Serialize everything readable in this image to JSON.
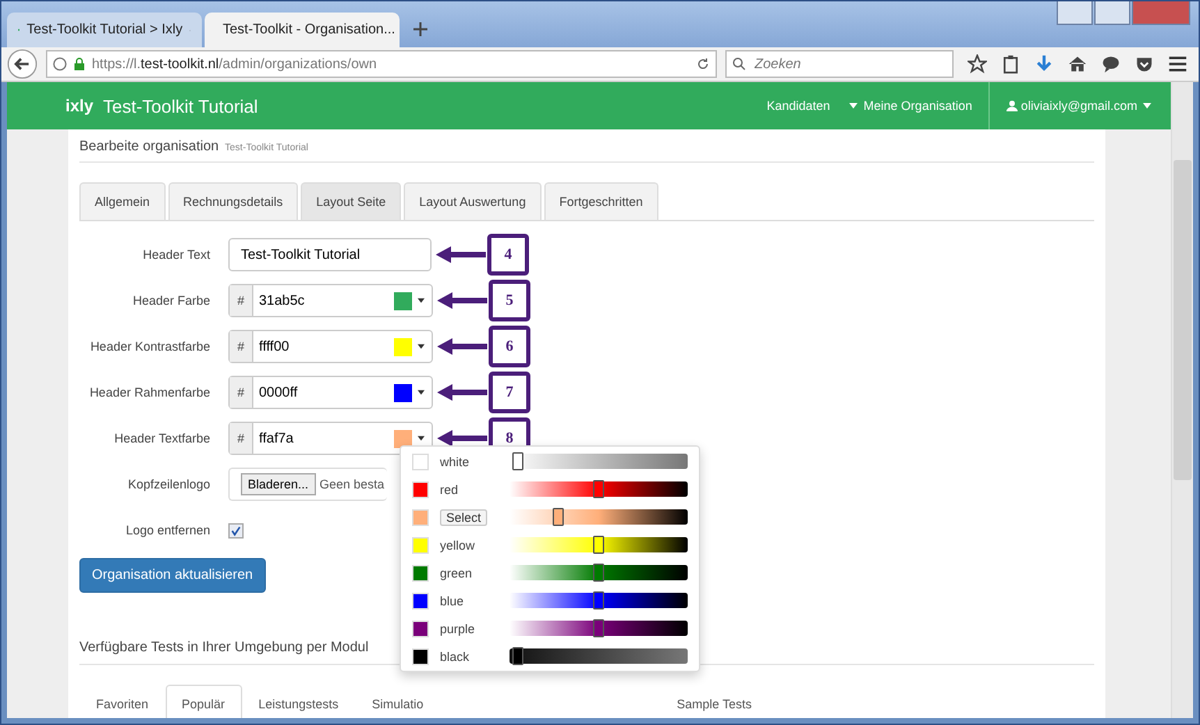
{
  "browser": {
    "tabs": [
      {
        "title": "Test-Toolkit Tutorial > Ixly",
        "selected": false
      },
      {
        "title": "Test-Toolkit - Organisation...",
        "selected": true
      }
    ],
    "url": "https://l.**test-toolkit.nl**/admin/organizations/own",
    "search": {
      "placeholder": "Zoeken"
    }
  },
  "navbar": {
    "logo": "ixly",
    "title": "Test-Toolkit Tutorial",
    "links": [
      {
        "label": "Kandidaten",
        "caret": false
      },
      {
        "label": "Meine Organisation",
        "caret": true
      }
    ],
    "user": {
      "label": "oliviaixly@gmail.com",
      "caret": true
    }
  },
  "heading": {
    "title": "Bearbeite organisation",
    "subtitle": "Test-Toolkit Tutorial"
  },
  "tabs": [
    {
      "label": "Allgemein",
      "selected": false
    },
    {
      "label": "Rechnungsdetails",
      "selected": false
    },
    {
      "label": "Layout Seite",
      "selected": true
    },
    {
      "label": "Layout Auswertung",
      "selected": false
    },
    {
      "label": "Fortgeschritten",
      "selected": false
    }
  ],
  "fields": [
    {
      "kind": "text",
      "label": "Header Text",
      "value": "Test-Toolkit Tutorial",
      "callout": "4"
    },
    {
      "kind": "color",
      "label": "Header Farbe",
      "prefix": "#",
      "value": "31ab5c",
      "color": "#31ab5c",
      "callout": "5"
    },
    {
      "kind": "color",
      "label": "Header Kontrastfarbe",
      "prefix": "#",
      "value": "ffff00",
      "color": "#ffff00",
      "callout": "6"
    },
    {
      "kind": "color",
      "label": "Header Rahmenfarbe",
      "prefix": "#",
      "value": "0000ff",
      "color": "#0000ff",
      "callout": "7"
    },
    {
      "kind": "color",
      "label": "Header Textfarbe",
      "prefix": "#",
      "value": "ffaf7a",
      "color": "#ffaf7a",
      "callout": "8"
    },
    {
      "kind": "file",
      "label": "Kopfzeilenlogo",
      "button": "Bladeren...",
      "value": "Geen besta"
    },
    {
      "kind": "checkbox",
      "label": "Logo entfernen",
      "checked": true
    }
  ],
  "submit": "Organisation aktualisieren",
  "picker": [
    {
      "kind": "label",
      "name": "white",
      "color": "#ffffff",
      "level": 0.02
    },
    {
      "kind": "label",
      "name": "red",
      "color": "#ff0000",
      "level": 0.5
    },
    {
      "kind": "select",
      "name": "Select",
      "color": "#ffaf7a",
      "level": 0.26
    },
    {
      "kind": "label",
      "name": "yellow",
      "color": "#ffff00",
      "level": 0.5
    },
    {
      "kind": "label",
      "name": "green",
      "color": "#007a00",
      "level": 0.5
    },
    {
      "kind": "label",
      "name": "blue",
      "color": "#0000ff",
      "level": 0.5
    },
    {
      "kind": "label",
      "name": "purple",
      "color": "#7a007a",
      "level": 0.5
    },
    {
      "kind": "label",
      "name": "black",
      "color": "#000000",
      "level": 0.02
    }
  ],
  "modules": {
    "title": "Verfügbare Tests in Ihrer Umgebung per Modul",
    "tabs": [
      {
        "label": "Favoriten",
        "selected": false
      },
      {
        "label": "Populär",
        "selected": true
      },
      {
        "label": "Leistungstests",
        "selected": false
      },
      {
        "label": "Simulatio",
        "selected": false
      },
      {
        "label": "Sample Tests",
        "selected": false
      }
    ]
  }
}
